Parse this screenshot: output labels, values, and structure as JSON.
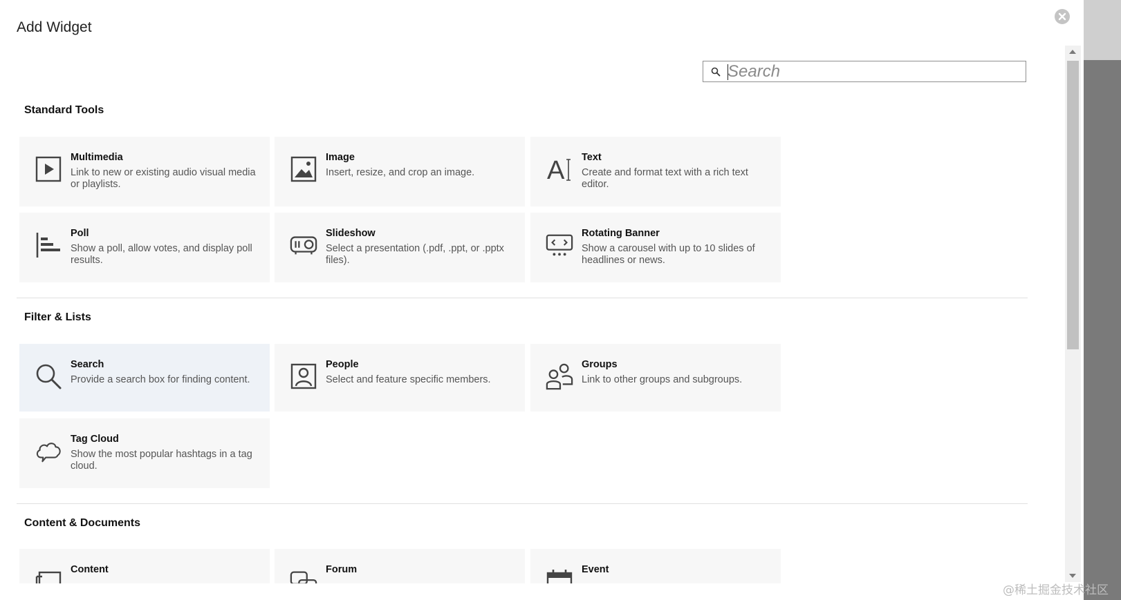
{
  "dialog": {
    "title": "Add Widget"
  },
  "search": {
    "placeholder": "Search",
    "value": ""
  },
  "sections": {
    "standard": {
      "title": "Standard Tools",
      "cards": [
        {
          "title": "Multimedia",
          "desc": "Link to new or existing audio visual media or playlists.",
          "icon": "video-play-icon"
        },
        {
          "title": "Image",
          "desc": "Insert, resize, and crop an image.",
          "icon": "image-icon"
        },
        {
          "title": "Text",
          "desc": "Create and format text with a rich text editor.",
          "icon": "text-icon"
        },
        {
          "title": "Poll",
          "desc": "Show a poll, allow votes, and display poll results.",
          "icon": "poll-icon"
        },
        {
          "title": "Slideshow",
          "desc": "Select a presentation (.pdf, .ppt, or .pptx files).",
          "icon": "projector-icon"
        },
        {
          "title": "Rotating Banner",
          "desc": "Show a carousel with up to 10 slides of headlines or news.",
          "icon": "carousel-icon"
        }
      ]
    },
    "filter": {
      "title": "Filter & Lists",
      "cards": [
        {
          "title": "Search",
          "desc": "Provide a search box for finding content.",
          "icon": "search-icon"
        },
        {
          "title": "People",
          "desc": "Select and feature specific members.",
          "icon": "person-card-icon"
        },
        {
          "title": "Groups",
          "desc": "Link to other groups and subgroups.",
          "icon": "groups-icon"
        },
        {
          "title": "Tag Cloud",
          "desc": "Show the most popular hashtags in a tag cloud.",
          "icon": "cloud-icon"
        }
      ]
    },
    "content": {
      "title": "Content & Documents",
      "cards": [
        {
          "title": "Content",
          "icon": "content-icon"
        },
        {
          "title": "Forum",
          "icon": "forum-icon"
        },
        {
          "title": "Event",
          "icon": "calendar-icon"
        }
      ]
    }
  },
  "watermark": "@稀土掘金技术社区"
}
